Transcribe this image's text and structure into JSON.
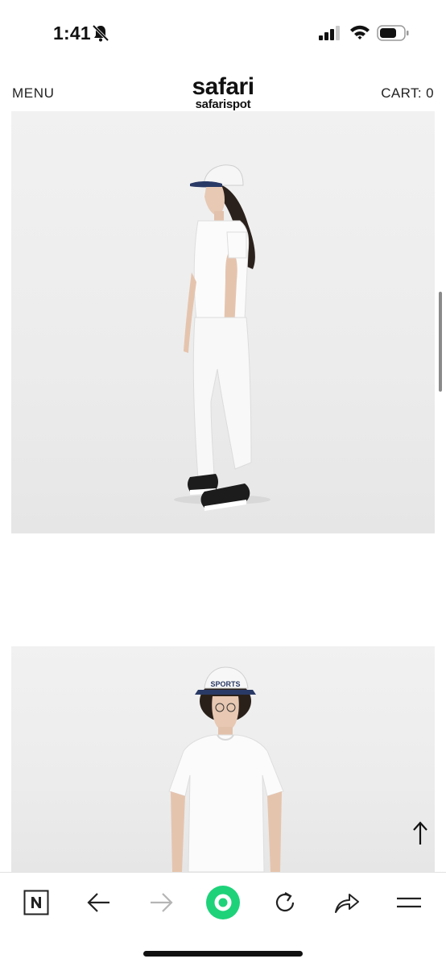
{
  "status_bar": {
    "time": "1:41"
  },
  "header": {
    "menu_label": "MENU",
    "logo_main": "safari",
    "logo_sub": "safarispot",
    "cart_label": "CART: 0"
  },
  "products": [
    {
      "image": "model-woman-side-white-tee-white-pants-cap"
    },
    {
      "image": "model-man-front-white-tee-bucket-hat",
      "hat_text": "SPORTS"
    }
  ],
  "icons": {
    "bell": "bell-slash-icon",
    "signal": "cellular-signal-icon",
    "wifi": "wifi-icon",
    "battery": "battery-icon",
    "back_to_top": "arrow-up-icon"
  },
  "toolbar": {
    "items": [
      "naver-icon",
      "back-arrow-icon",
      "forward-arrow-icon",
      "green-record-icon",
      "reload-icon",
      "share-icon",
      "menu-icon"
    ]
  },
  "colors": {
    "accent_green": "#1ed27a",
    "background": "#ffffff",
    "photo_bg": "#ececec",
    "text": "#111111",
    "cap_navy": "#2a3a66"
  }
}
